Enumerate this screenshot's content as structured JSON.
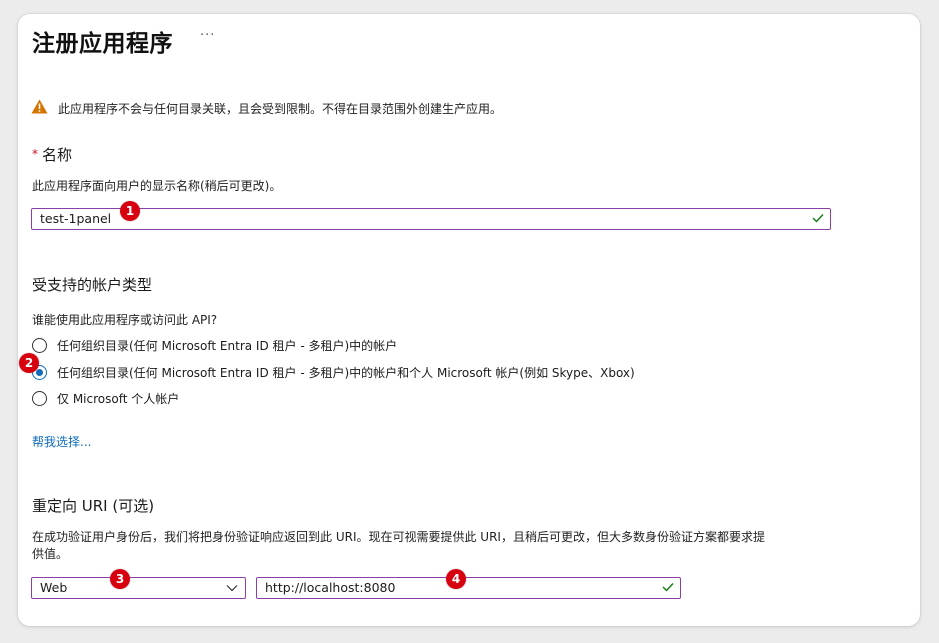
{
  "header": {
    "title": "注册应用程序",
    "more": "···"
  },
  "warning": {
    "icon": "warning-triangle-icon",
    "text": "此应用程序不会与任何目录关联，且会受到限制。不得在目录范围外创建生产应用。",
    "color": "#d47500"
  },
  "name_section": {
    "required_mark": "*",
    "label": "名称",
    "help": "此应用程序面向用户的显示名称(稍后可更改)。",
    "value": "test-1panel",
    "valid_icon": "checkmark-icon"
  },
  "account_section": {
    "title": "受支持的帐户类型",
    "question": "谁能使用此应用程序或访问此 API?",
    "options": [
      {
        "label": "任何组织目录(任何 Microsoft Entra ID 租户 - 多租户)中的帐户",
        "selected": false
      },
      {
        "label": "任何组织目录(任何 Microsoft Entra ID 租户 - 多租户)中的帐户和个人 Microsoft 帐户(例如 Skype、Xbox)",
        "selected": true
      },
      {
        "label": "仅 Microsoft 个人帐户",
        "selected": false
      }
    ],
    "help_link": "帮我选择..."
  },
  "redirect_section": {
    "title": "重定向 URI (可选)",
    "help_line1": "在成功验证用户身份后，我们将把身份验证响应返回到此 URI。现在可视需要提供此 URI，且稍后可更改，但大多数身份验证方案都要求提",
    "help_line2": "供值。",
    "platform_value": "Web",
    "uri_value": "http://localhost:8080"
  },
  "badges": [
    "1",
    "2",
    "3",
    "4"
  ],
  "colors": {
    "accent": "#0f6cbd",
    "input_border": "#8a3fa7",
    "badge": "#d6000f",
    "valid": "#107c10"
  }
}
